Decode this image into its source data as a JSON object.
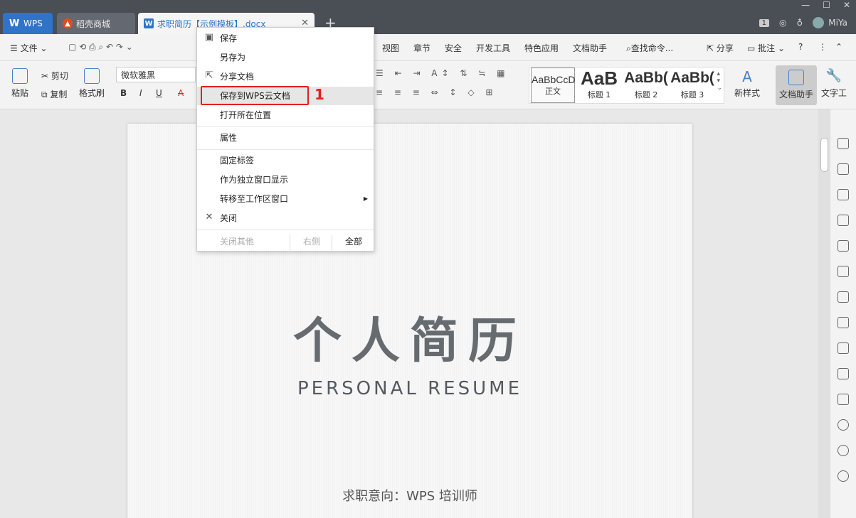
{
  "tabs": [
    {
      "label": "WPS",
      "icon": "wps-logo-icon"
    },
    {
      "label": "稻壳商城",
      "icon": "docer-flame-icon"
    },
    {
      "label": "求职简历【示例模板】.docx",
      "icon": "word-doc-icon"
    }
  ],
  "tab_add": "+",
  "window": {
    "user": "MiYa",
    "badge": "1"
  },
  "menu": {
    "file": "文件",
    "items": [
      "视图",
      "章节",
      "安全",
      "开发工具",
      "特色应用",
      "文档助手"
    ],
    "search": "查找命令...",
    "share": "分享",
    "comment": "批注"
  },
  "ribbon": {
    "paste": "粘贴",
    "cut": "剪切",
    "copy": "复制",
    "format_painter": "格式刷",
    "font_name": "微软雅黑",
    "bold": "B",
    "italic": "I",
    "underline": "U",
    "styles": [
      {
        "preview": "AaBbCcD",
        "label": "正文"
      },
      {
        "preview": "AaB",
        "label": "标题 1"
      },
      {
        "preview": "AaBb(",
        "label": "标题 2"
      },
      {
        "preview": "AaBb(",
        "label": "标题 3"
      }
    ],
    "new_style": "新样式",
    "doc_assistant": "文档助手",
    "text_tools": "文字工"
  },
  "context_menu": {
    "items": [
      "保存",
      "另存为",
      "分享文档",
      "保存到WPS云文档",
      "打开所在位置",
      "属性",
      "固定标签",
      "作为独立窗口显示",
      "转移至工作区窗口",
      "关闭"
    ],
    "footer": {
      "close_others": "关闭其他",
      "right": "右侧",
      "all": "全部"
    },
    "annotation": "1"
  },
  "document": {
    "title": "个人简历",
    "subtitle": "PERSONAL RESUME",
    "job": "求职意向：WPS 培训师"
  }
}
